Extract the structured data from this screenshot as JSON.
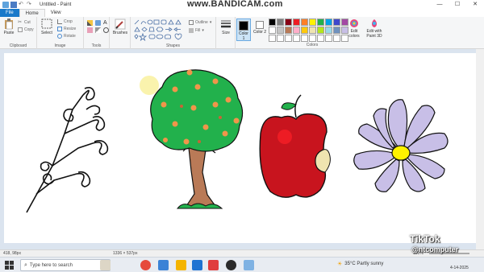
{
  "titlebar": {
    "title": "Untitled - Paint",
    "watermark": "www.BANDICAM.com",
    "minimize": "—",
    "maximize": "☐",
    "close": "✕"
  },
  "tabs": [
    {
      "label": "File"
    },
    {
      "label": "Home"
    },
    {
      "label": "View"
    }
  ],
  "ribbon": {
    "clipboard": {
      "paste": "Paste",
      "cut": "Cut",
      "copy": "Copy",
      "label": "Clipboard"
    },
    "image": {
      "select": "Select",
      "crop": "Crop",
      "resize": "Resize",
      "rotate": "Rotate",
      "label": "Image"
    },
    "tools": {
      "label": "Tools"
    },
    "brushes": {
      "label": "Brushes"
    },
    "shapes": {
      "outline": "Outline",
      "fill": "Fill",
      "label": "Shapes"
    },
    "size": {
      "label": "Size"
    },
    "colors": {
      "color1": "Color 1",
      "color2": "Color 2",
      "edit_colors": "Edit colors",
      "edit_3d": "Edit with Paint 3D",
      "label": "Colors",
      "palette": [
        "#000000",
        "#7f7f7f",
        "#880015",
        "#ed1c24",
        "#ff7f27",
        "#fff200",
        "#22b14c",
        "#00a2e8",
        "#3f48cc",
        "#a349a4",
        "#ffffff",
        "#c3c3c3",
        "#b97a57",
        "#ffaec9",
        "#ffc90e",
        "#efe4b0",
        "#b5e61d",
        "#99d9ea",
        "#7092be",
        "#c8bfe7",
        "#ffffff",
        "#ffffff",
        "#ffffff",
        "#ffffff",
        "#ffffff",
        "#ffffff",
        "#ffffff",
        "#ffffff",
        "#ffffff",
        "#ffffff"
      ]
    }
  },
  "status": {
    "cursor": "418, 98px",
    "selection": "",
    "canvas_size": "1336 × 537px",
    "zoom": "100%"
  },
  "taskbar": {
    "search_placeholder": "Type here to search",
    "weather": "35°C  Partly sunny",
    "date": "4-14-2025"
  },
  "overlay": {
    "tiktok": "TikTok",
    "handle": "@ntcomputer"
  },
  "colors": {
    "accent": "#1979ca",
    "tree_green": "#22b14c",
    "apple_red": "#c8141e",
    "flower_petal": "#c8bfe7",
    "flower_center": "#fff200"
  }
}
